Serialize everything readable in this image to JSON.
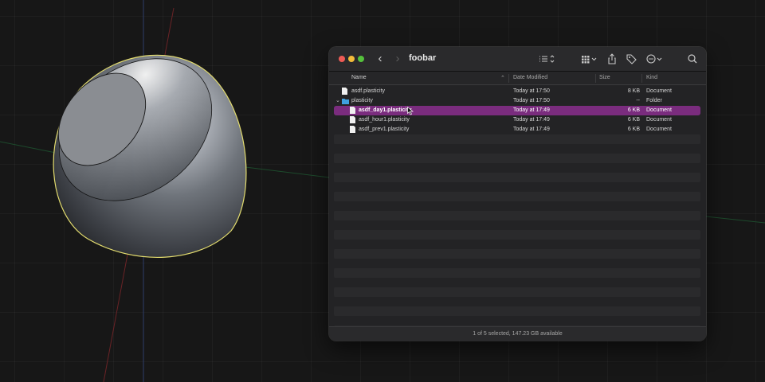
{
  "window": {
    "title": "foobar"
  },
  "columns": {
    "name": "Name",
    "date_modified": "Date Modified",
    "size": "Size",
    "kind": "Kind"
  },
  "rows": [
    {
      "name": "asdf.plasticity",
      "date": "Today at 17:50",
      "size": "8 KB",
      "kind": "Document",
      "type": "document",
      "indent": 0,
      "selected": false
    },
    {
      "name": "plasticity",
      "date": "Today at 17:50",
      "size": "--",
      "kind": "Folder",
      "type": "folder",
      "indent": 0,
      "selected": false,
      "expanded": true
    },
    {
      "name": "asdf_day1.plasticity",
      "date": "Today at 17:49",
      "size": "6 KB",
      "kind": "Document",
      "type": "document",
      "indent": 1,
      "selected": true
    },
    {
      "name": "asdf_hour1.plasticity",
      "date": "Today at 17:49",
      "size": "6 KB",
      "kind": "Document",
      "type": "document",
      "indent": 1,
      "selected": false
    },
    {
      "name": "asdf_prev1.plasticity",
      "date": "Today at 17:49",
      "size": "6 KB",
      "kind": "Document",
      "type": "document",
      "indent": 1,
      "selected": false
    }
  ],
  "status": {
    "text": "1 of 5 selected, 147.23 GB available"
  },
  "colors": {
    "selection": "#7a2c7e",
    "folder": "#3fa0e0",
    "outline": "#e8e07a"
  },
  "icons": [
    "back-icon",
    "forward-icon",
    "list-view-icon",
    "grid-view-icon",
    "share-icon",
    "tag-icon",
    "more-icon",
    "search-icon"
  ]
}
